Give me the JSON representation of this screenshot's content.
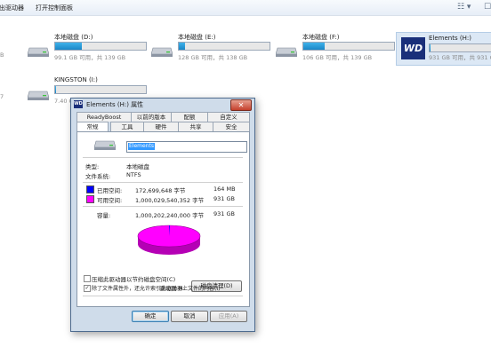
{
  "toolbar": {
    "item1": "弹出驱动器",
    "item2": "打开控制面板",
    "right_view": "☷ ▾",
    "right_extra": "☐"
  },
  "left_partial": {
    "row1": "B",
    "row2": "7"
  },
  "drives": [
    {
      "name": "本地磁盘 (D:)",
      "free": "99.1 GB 可用，共 139 GB",
      "usage": 0.29
    },
    {
      "name": "本地磁盘 (E:)",
      "free": "128 GB 可用，共 138 GB",
      "usage": 0.07
    },
    {
      "name": "本地磁盘 (F:)",
      "free": "106 GB 可用，共 139 GB",
      "usage": 0.24
    },
    {
      "name": "Elements (H:)",
      "free": "931 GB 可用，共 931 GB",
      "usage": 0.01
    },
    {
      "name": "KINGSTON (I:)",
      "free": "7.40 GB 可用，共 7.43 GB",
      "usage": 0.01
    }
  ],
  "wd_logo": "WD",
  "dialog": {
    "icon": "WD",
    "title": "Elements (H:) 属性",
    "close": "✕",
    "tabs_top": [
      "ReadyBoost",
      "以前的版本",
      "配额",
      "自定义"
    ],
    "tabs_bottom": [
      "常规",
      "工具",
      "硬件",
      "共享",
      "安全"
    ],
    "volume_name": "Elements",
    "type_label": "类型:",
    "type_value": "本地磁盘",
    "fs_label": "文件系统:",
    "fs_value": "NTFS",
    "used_label": "已用空间:",
    "used_bytes": "172,699,648 字节",
    "used_size": "164 MB",
    "free_label": "可用空间:",
    "free_bytes": "1,000,029,540,352 字节",
    "free_size": "931 GB",
    "capacity_label": "容量:",
    "capacity_bytes": "1,000,202,240,000 字节",
    "capacity_size": "931 GB",
    "drive_label": "驱动器 H:",
    "cleanup": "磁盘清理(D)",
    "compress": "压缩此驱动器以节约磁盘空间(C)",
    "index": "除了文件属性外，还允许索引此驱动器上文件的内容(I)",
    "ok": "确定",
    "cancel": "取消",
    "apply": "应用(A)",
    "used_fraction": 0.0002
  },
  "colors": {
    "used": "#0000ff",
    "free": "#ff00ff"
  }
}
